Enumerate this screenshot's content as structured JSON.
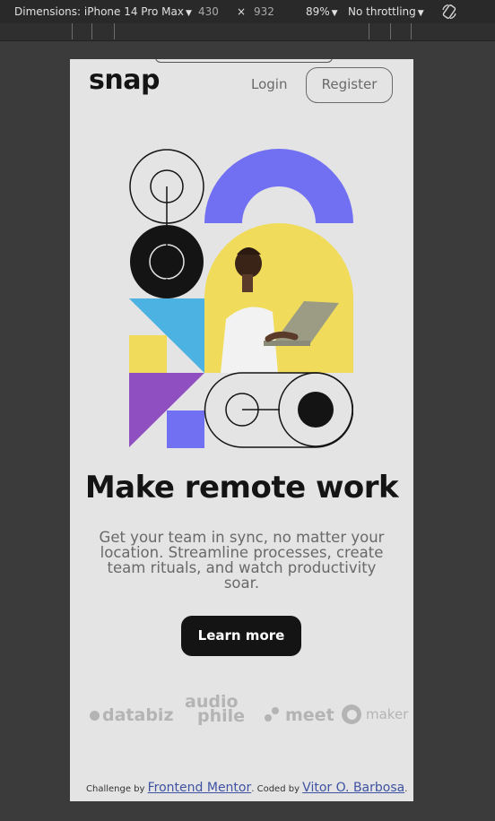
{
  "devtools": {
    "dimensions_label": "Dimensions: iPhone 14 Pro Max",
    "width": "430",
    "separator": "×",
    "height": "932",
    "zoom": "89%",
    "throttling": "No throttling",
    "caret": "▼"
  },
  "header": {
    "logo": "snap",
    "login": "Login",
    "register": "Register"
  },
  "hero": {
    "headline": "Make remote work",
    "description": "Get your team in sync, no matter your location. Streamline processes, create team rituals, and watch productivity soar.",
    "cta": "Learn more"
  },
  "clients": {
    "databiz": "databiz",
    "audiophile_top": "audio",
    "audiophile_bottom": "phile",
    "meet": "meet",
    "maker": "maker"
  },
  "footer": {
    "challenge_prefix": "Challenge by ",
    "challenge_link": "Frontend Mentor",
    "coded_prefix": ". Coded by ",
    "coded_link": "Vitor O. Barbosa",
    "suffix": "."
  },
  "colors": {
    "background": "#e4e4e4",
    "text_dark": "#141414",
    "text_medium": "#696969",
    "accent_purple": "#7270f2",
    "accent_yellow": "#f0dc5a",
    "accent_blue": "#4cb2e2",
    "accent_violet": "#8f4fc1"
  }
}
